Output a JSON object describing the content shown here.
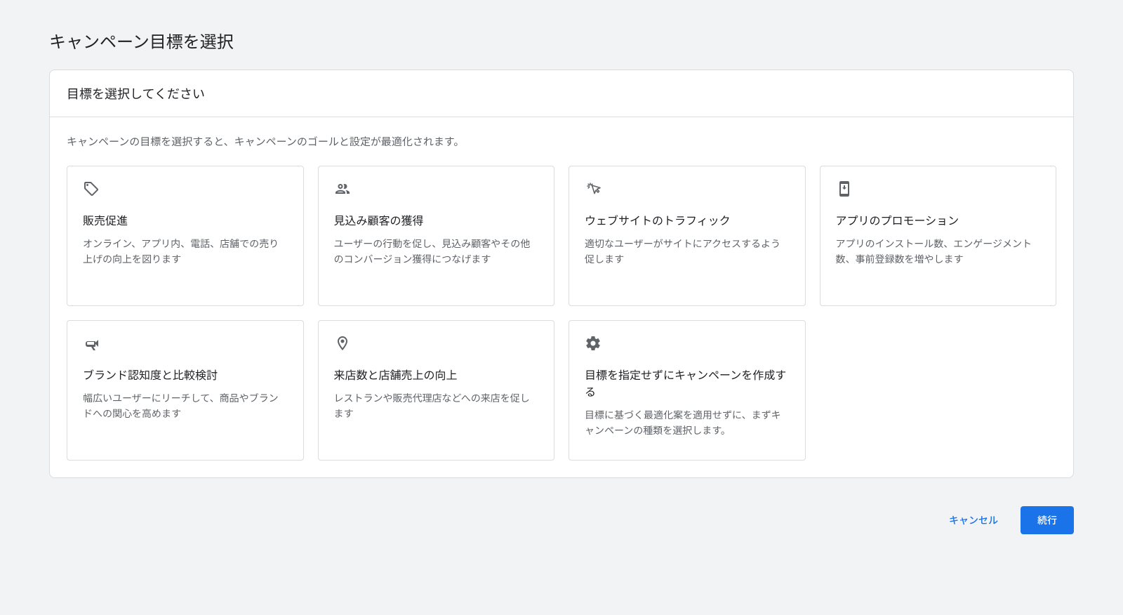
{
  "page_title": "キャンペーン目標を選択",
  "card": {
    "header_title": "目標を選択してください",
    "description": "キャンペーンの目標を選択すると、キャンペーンのゴールと設定が最適化されます。"
  },
  "goals": [
    {
      "icon": "tag-icon",
      "title": "販売促進",
      "desc": "オンライン、アプリ内、電話、店舗での売り上げの向上を図ります"
    },
    {
      "icon": "people-icon",
      "title": "見込み顧客の獲得",
      "desc": "ユーザーの行動を促し、見込み顧客やその他のコンバージョン獲得につなげます"
    },
    {
      "icon": "cursor-click-icon",
      "title": "ウェブサイトのトラフィック",
      "desc": "適切なユーザーがサイトにアクセスするよう促します"
    },
    {
      "icon": "phone-download-icon",
      "title": "アプリのプロモーション",
      "desc": "アプリのインストール数、エンゲージメント数、事前登録数を増やします"
    },
    {
      "icon": "megaphone-icon",
      "title": "ブランド認知度と比較検討",
      "desc": "幅広いユーザーにリーチして、商品やブランドへの関心を高めます"
    },
    {
      "icon": "location-pin-icon",
      "title": "来店数と店舗売上の向上",
      "desc": "レストランや販売代理店などへの来店を促します"
    },
    {
      "icon": "gear-icon",
      "title": "目標を指定せずにキャンペーンを作成する",
      "desc": "目標に基づく最適化案を適用せずに、まずキャンペーンの種類を選択します。"
    }
  ],
  "footer": {
    "cancel_label": "キャンセル",
    "continue_label": "続行"
  }
}
